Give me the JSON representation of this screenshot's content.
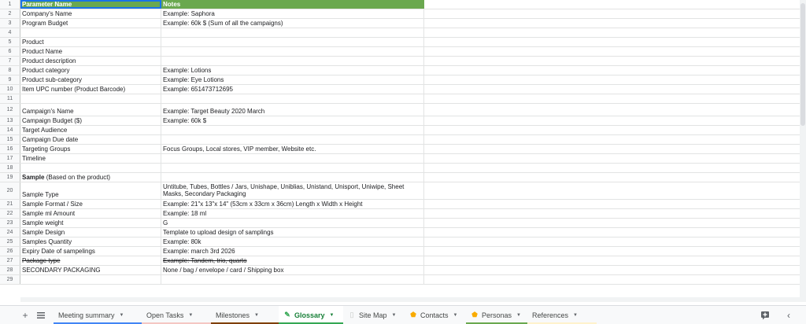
{
  "header": {
    "col1": "Parameter Name",
    "col2": "Notes"
  },
  "rows": [
    {
      "num": "2",
      "name": "Company's Name",
      "note": "Example: Saphora"
    },
    {
      "num": "3",
      "name": "Program Budget",
      "note": "Example: 60k $ (Sum of all the campaigns)"
    },
    {
      "num": "4",
      "name": "",
      "note": ""
    },
    {
      "num": "5",
      "name": "Product",
      "note": ""
    },
    {
      "num": "6",
      "name": "Product Name",
      "note": ""
    },
    {
      "num": "7",
      "name": "Product description",
      "note": ""
    },
    {
      "num": "8",
      "name": "Product category",
      "note": "Example: Lotions"
    },
    {
      "num": "9",
      "name": "Product sub-category",
      "note": "Example: Eye Lotions"
    },
    {
      "num": "10",
      "name": "Item UPC number (Product Barcode)",
      "note": "Example: 651473712695"
    },
    {
      "num": "11",
      "name": "",
      "note": ""
    },
    {
      "num": "12",
      "name": "Campaign's Name",
      "note": "Example: Target Beauty 2020 March"
    },
    {
      "num": "13",
      "name": "Campaign Budget ($)",
      "note": "Example: 60k $"
    },
    {
      "num": "14",
      "name": "Target Audience",
      "note": ""
    },
    {
      "num": "15",
      "name": "Campaign Due date",
      "note": ""
    },
    {
      "num": "16",
      "name": "Targeting Groups",
      "note": "Focus Groups, Local stores, VIP member, Website etc."
    },
    {
      "num": "17",
      "name": "Timeline",
      "note": ""
    },
    {
      "num": "18",
      "name": "",
      "note": ""
    },
    {
      "num": "19",
      "name_bold": "Sample",
      "name_rest": " (Based on the product)",
      "note": ""
    },
    {
      "num": "20",
      "name": "Sample Type",
      "note": "Untitube, Tubes, Bottles / Jars, Unishape, Uniblias, Unistand, Unisport, Uniwipe, Sheet Masks, Secondary Packaging"
    },
    {
      "num": "21",
      "name": "Sample Format / Size",
      "note": "Example: 21\"x 13\"x 14\" (53cm x 33cm x 36cm) Length x Width x Height"
    },
    {
      "num": "22",
      "name": "Sample ml Amount",
      "note": "Example: 18 ml"
    },
    {
      "num": "23",
      "name": "Sample weight",
      "note": "G"
    },
    {
      "num": "24",
      "name": "Sample Design",
      "note": "Template to upload design of samplings"
    },
    {
      "num": "25",
      "name": "Samples Quantity",
      "note": "Example: 80k"
    },
    {
      "num": "26",
      "name": "Expiry Date of sampelings",
      "note": "Example: march 3rd 2026"
    },
    {
      "num": "27",
      "name": "Package type",
      "note": "Example: Tandem, trio, quarto"
    },
    {
      "num": "28",
      "name": "SECONDARY PACKAGING",
      "note": "None / bag / envelope /  card / Shipping box"
    },
    {
      "num": "29",
      "name": "",
      "note": ""
    }
  ],
  "tabs": [
    {
      "label": "Meeting summary",
      "icon": "none",
      "color": "#4285f4"
    },
    {
      "label": "Open Tasks",
      "icon": "none",
      "color": "#f4c7c3"
    },
    {
      "label": "Milestones",
      "icon": "none",
      "color": "#7f3f00"
    },
    {
      "label": "Glossary",
      "icon": "pencil-icon",
      "color": "#34a853"
    },
    {
      "label": "Site Map",
      "icon": "none",
      "color": "#ffffff"
    },
    {
      "label": "Contacts",
      "icon": "shield-icon",
      "color": "#ffffff"
    },
    {
      "label": "Personas",
      "icon": "shield-icon",
      "color": "#6aa84f"
    },
    {
      "label": "References",
      "icon": "none",
      "color": "#fff2cc"
    }
  ],
  "colors": {
    "header_bg": "#6aa84f",
    "active_tab_text": "#188038",
    "selection": "#1a73e8"
  }
}
